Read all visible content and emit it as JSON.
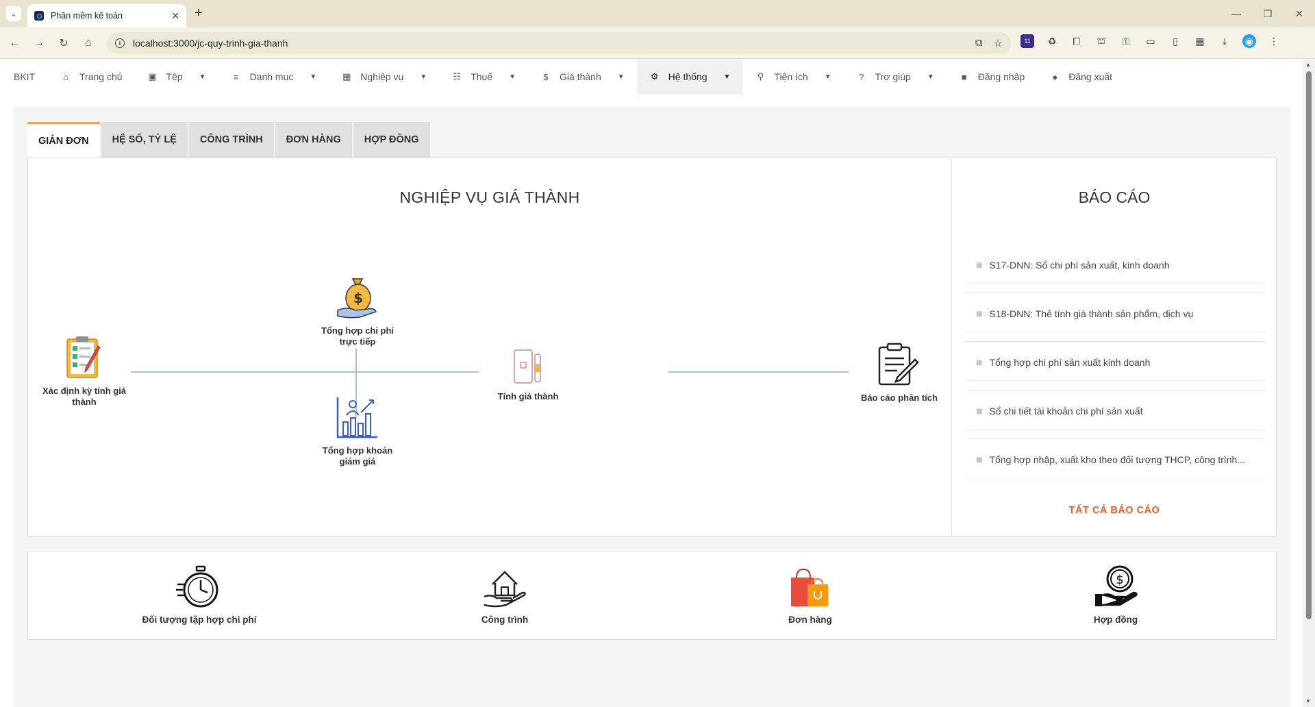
{
  "browser": {
    "tab_title": "Phần mềm kế toán",
    "url": "localhost:3000/jc-quy-trinh-gia-thanh",
    "extension_badge": "11"
  },
  "nav": {
    "brand": "BKIT",
    "items": [
      {
        "label": "Trang chủ",
        "icon": "home-icon",
        "has_caret": false
      },
      {
        "label": "Tệp",
        "icon": "save-icon",
        "has_caret": true
      },
      {
        "label": "Danh mục",
        "icon": "list-icon",
        "has_caret": true
      },
      {
        "label": "Nghiệp vụ",
        "icon": "grid-edit-icon",
        "has_caret": true
      },
      {
        "label": "Thuế",
        "icon": "checklist-icon",
        "has_caret": true
      },
      {
        "label": "Giá thành",
        "icon": "dollar-circle-icon",
        "has_caret": true
      },
      {
        "label": "Hệ thống",
        "icon": "gear-icon",
        "has_caret": true,
        "active": true
      },
      {
        "label": "Tiện ích",
        "icon": "walk-icon",
        "has_caret": true
      },
      {
        "label": "Trợ giúp",
        "icon": "help-icon",
        "has_caret": true
      },
      {
        "label": "Đăng nhập",
        "icon": "login-icon",
        "has_caret": false
      },
      {
        "label": "Đăng xuất",
        "icon": "logout-icon",
        "has_caret": false
      }
    ]
  },
  "tabs": [
    "GIẢN ĐƠN",
    "HỆ SỐ, TỶ LỆ",
    "CÔNG TRÌNH",
    "ĐƠN HÀNG",
    "HỢP ĐỒNG"
  ],
  "operations": {
    "title": "NGHIỆP VỤ GIÁ THÀNH",
    "nodes": {
      "period": "Xác định kỳ tính giá thành",
      "direct_costs": "Tổng hợp chi phí trực tiếp",
      "discounts": "Tổng hợp khoản giảm giá",
      "calculate": "Tính giá thành",
      "analysis": "Báo cáo phân tích"
    }
  },
  "reports": {
    "title": "BÁO CÁO",
    "items": [
      "S17-DNN: Sổ chi phí sản xuất, kinh doanh",
      "S18-DNN: Thẻ tính giá thành sản phẩm, dịch vụ",
      "Tổng hợp chi phí sản xuất kinh doanh",
      "Sổ chi tiết tài khoản chi phí sản xuất",
      "Tổng hợp nhập, xuất kho theo đối tượng THCP, công trình..."
    ],
    "all_label": "TẤT CẢ BÁO CÁO"
  },
  "shortcuts": [
    "Đối tượng tập hợp chi phí",
    "Công trình",
    "Đơn hàng",
    "Hợp đồng"
  ],
  "colors": {
    "accent_orange": "#f15a24",
    "tab_active_border": "#f0a35a",
    "flow_line": "#a8c3d6"
  }
}
